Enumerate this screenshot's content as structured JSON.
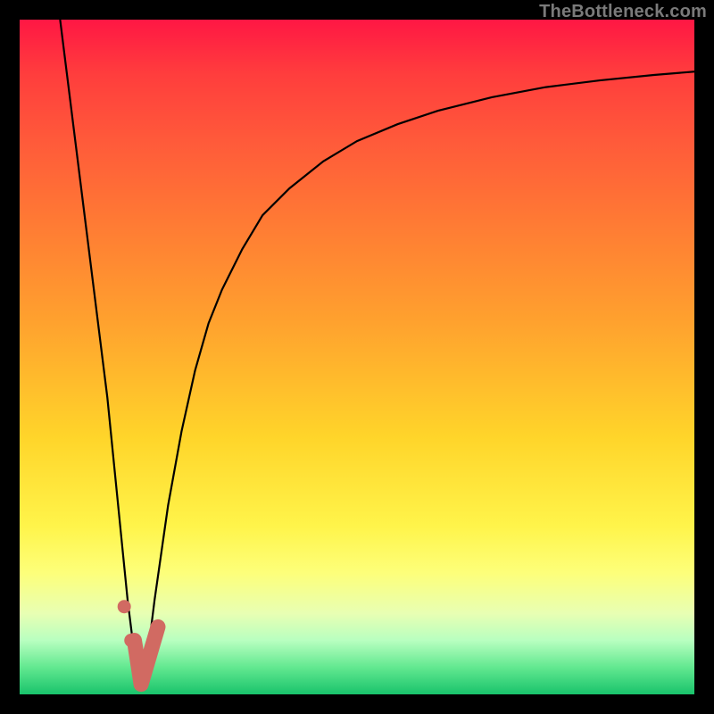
{
  "watermark": "TheBottleneck.com",
  "colors": {
    "frame": "#000000",
    "curve_stroke": "#000000",
    "marker_stroke": "#d16a62",
    "marker_fill": "#d16a62"
  },
  "chart_data": {
    "type": "line",
    "title": "",
    "xlabel": "",
    "ylabel": "",
    "xlim": [
      0,
      100
    ],
    "ylim": [
      0,
      100
    ],
    "grid": false,
    "series": [
      {
        "name": "left-branch",
        "x": [
          6,
          7,
          8,
          9,
          10,
          11,
          12,
          13,
          14,
          15,
          16,
          17,
          18
        ],
        "y": [
          100,
          92,
          84,
          76,
          68,
          60,
          52,
          44,
          34,
          24,
          14,
          6,
          1
        ]
      },
      {
        "name": "right-branch",
        "x": [
          18,
          19,
          20,
          22,
          24,
          26,
          28,
          30,
          33,
          36,
          40,
          45,
          50,
          56,
          62,
          70,
          78,
          86,
          94,
          100
        ],
        "y": [
          1,
          6,
          14,
          28,
          39,
          48,
          55,
          60,
          66,
          71,
          75,
          79,
          82,
          84.5,
          86.5,
          88.5,
          90,
          91,
          91.8,
          92.3
        ]
      }
    ],
    "markers": {
      "name": "tick-points",
      "shape": "tick-curve",
      "points": [
        {
          "x": 15.5,
          "y": 13
        },
        {
          "x": 16.5,
          "y": 8
        }
      ],
      "tick": {
        "start": {
          "x": 17.0,
          "y": 8
        },
        "corner": {
          "x": 18.0,
          "y": 1.5
        },
        "end": {
          "x": 20.5,
          "y": 10
        }
      }
    }
  }
}
